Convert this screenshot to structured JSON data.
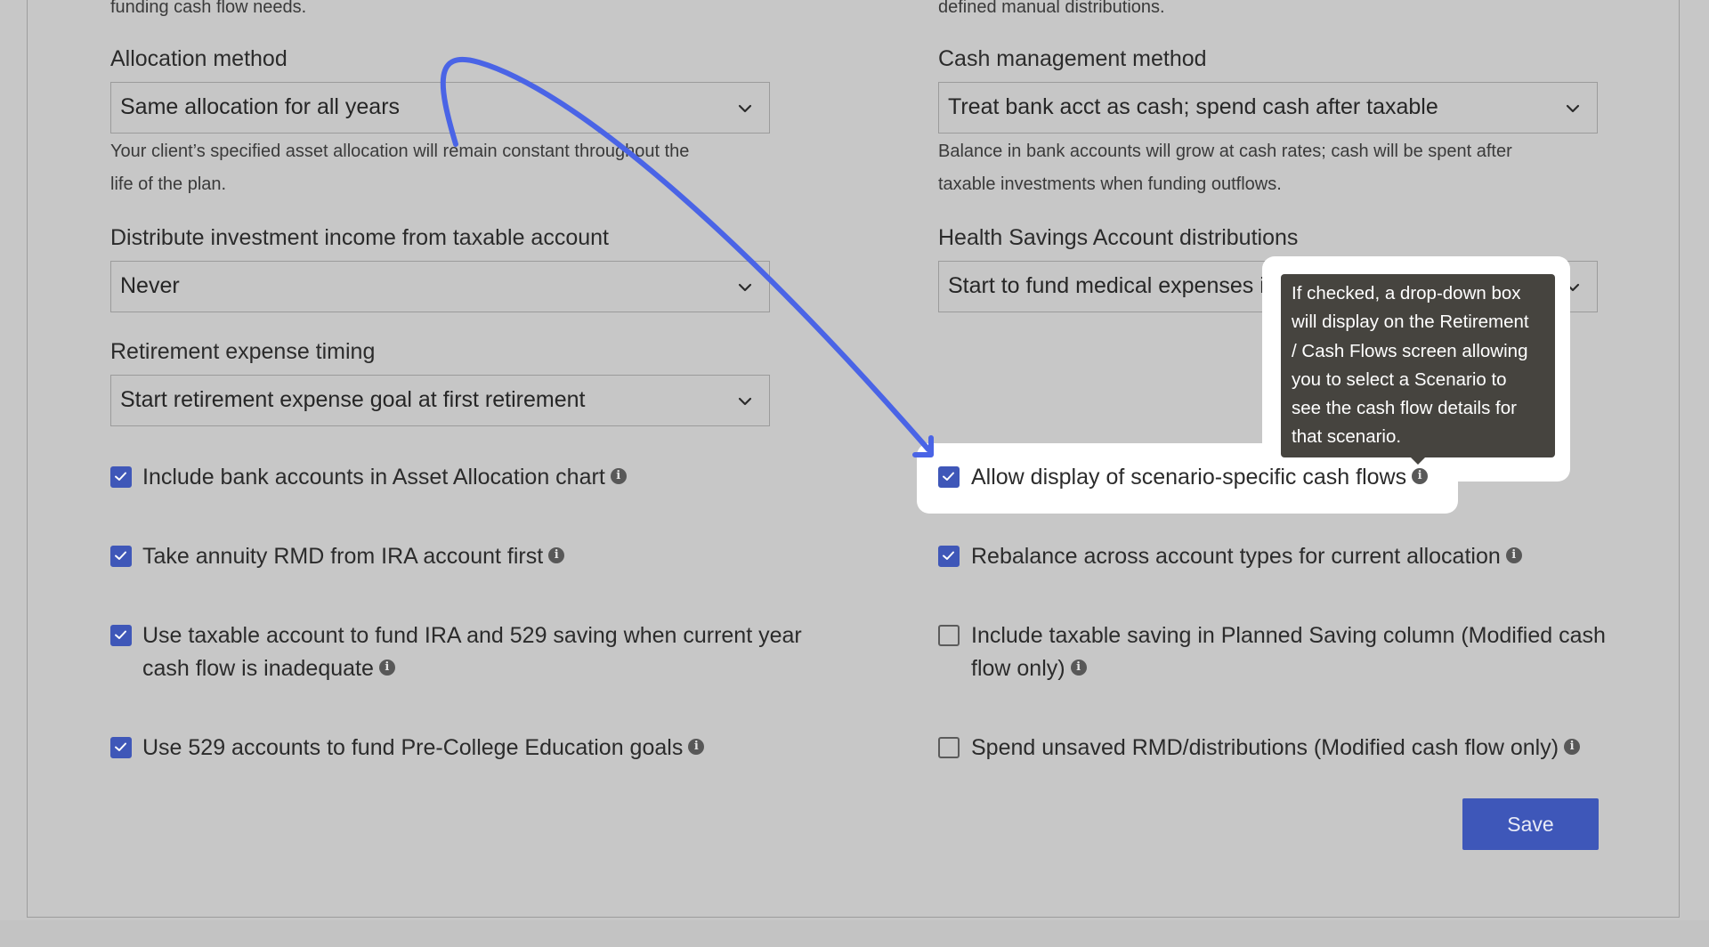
{
  "left_column": {
    "top_text": "funding cash flow needs.",
    "allocation_method": {
      "label": "Allocation method",
      "value": "Same allocation for all years",
      "help_line1": "Your client’s specified asset allocation will remain constant throughout the",
      "help_line2": "life of the plan."
    },
    "distribute_income": {
      "label": "Distribute investment income from taxable account",
      "value": "Never"
    },
    "retirement_timing": {
      "label": "Retirement expense timing",
      "value": "Start retirement expense goal at first retirement"
    },
    "options": [
      {
        "label": "Include bank accounts in Asset Allocation chart",
        "checked": true
      },
      {
        "label": "Take annuity RMD from IRA account first",
        "checked": true
      },
      {
        "label_line1": "Use taxable account to fund IRA and 529 saving when current year",
        "label_line2": "cash flow is inadequate",
        "checked": true
      },
      {
        "label": "Use 529 accounts to fund Pre-College Education goals",
        "checked": true
      }
    ]
  },
  "right_column": {
    "top_text": "defined manual distributions.",
    "cash_management": {
      "label": "Cash management method",
      "value": "Treat bank acct as cash; spend cash after taxable",
      "help_line1": "Balance in bank accounts will grow at cash rates; cash will be spent after",
      "help_line2": "taxable investments when funding outflows."
    },
    "hsa": {
      "label": "Health Savings Account distributions",
      "value": "Start to fund medical expenses im"
    },
    "options": [
      {
        "label": "Allow display of scenario-specific cash flows",
        "checked": true
      },
      {
        "label": "Rebalance across account types for current allocation",
        "checked": true
      },
      {
        "label_line1": "Include taxable saving in Planned Saving column (Modified cash",
        "label_line2": "flow only)",
        "checked": false
      },
      {
        "label": "Spend unsaved RMD/distributions (Modified cash flow only)",
        "checked": false
      }
    ]
  },
  "tooltip": {
    "lines": [
      "If checked, a drop-down box",
      "will display on the Retirement",
      "/ Cash Flows screen allowing",
      "you to select a Scenario to",
      "see the cash flow details for",
      "that scenario."
    ]
  },
  "save_button": {
    "label": "Save"
  },
  "icons": {
    "info": "info-icon",
    "check": "checkmark-icon",
    "chevron": "chevron-down-icon",
    "annotation": "annotation-arrow"
  },
  "colors": {
    "background": "#c7c7c7",
    "accent": "#3f57b8",
    "arrow": "#4a64e6",
    "tooltip": "#46443f",
    "highlight": "#ffffff"
  }
}
